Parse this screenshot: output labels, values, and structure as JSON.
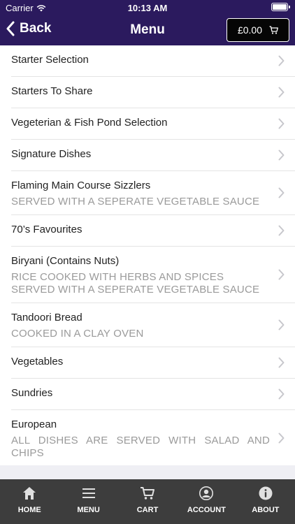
{
  "status_bar": {
    "carrier": "Carrier",
    "time": "10:13 AM"
  },
  "nav": {
    "back_label": "Back",
    "title": "Menu",
    "cart_total": "£0.00"
  },
  "menu_items": [
    {
      "title": "Starter Selection",
      "subtitle": ""
    },
    {
      "title": "Starters To Share",
      "subtitle": ""
    },
    {
      "title": "Vegeterian & Fish Pond Selection",
      "subtitle": ""
    },
    {
      "title": "Signature Dishes",
      "subtitle": ""
    },
    {
      "title": "Flaming Main Course Sizzlers",
      "subtitle": "SERVED WITH A SEPERATE VEGETABLE SAUCE"
    },
    {
      "title": "70’s Favourites",
      "subtitle": ""
    },
    {
      "title": "Biryani (Contains Nuts)",
      "subtitle": "RICE COOKED WITH HERBS AND SPICES SERVED WITH A SEPERATE VEGETABLE SAUCE"
    },
    {
      "title": "Tandoori Bread",
      "subtitle": "COOKED IN A CLAY OVEN"
    },
    {
      "title": "Vegetables",
      "subtitle": ""
    },
    {
      "title": "Sundries",
      "subtitle": ""
    },
    {
      "title": "European",
      "subtitle": "ALL DISHES ARE SERVED WITH SALAD AND CHIPS"
    }
  ],
  "tabbar": {
    "home": "HOME",
    "menu": "MENU",
    "cart": "CART",
    "account": "ACCOUNT",
    "about": "ABOUT"
  },
  "icons": {
    "back": "chevron-left-icon",
    "cart": "cart-icon",
    "row": "chevron-right-icon",
    "home": "home-icon",
    "menu": "hamburger-icon",
    "account": "user-icon",
    "about": "info-icon"
  },
  "colors": {
    "header_bg": "#2b1a5e",
    "tabbar_bg": "#3d3d3d",
    "subtitle": "#9a9a9a"
  }
}
